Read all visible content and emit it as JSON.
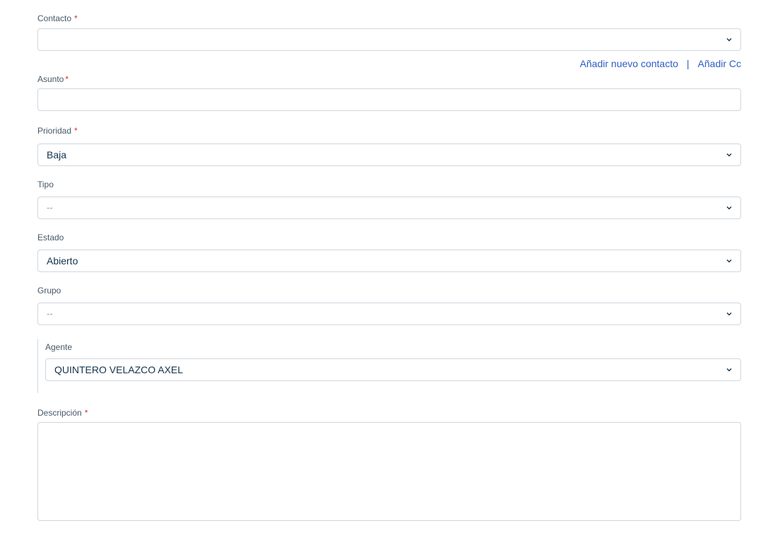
{
  "form": {
    "contact": {
      "label": "Contacto",
      "required_mark": "*",
      "value": ""
    },
    "contact_links": {
      "add_contact": "Añadir nuevo contacto",
      "separator": "|",
      "add_cc": "Añadir Cc"
    },
    "subject": {
      "label": "Asunto",
      "required_mark": "*",
      "value": ""
    },
    "priority": {
      "label": "Prioridad",
      "required_mark": "*",
      "value": "Baja"
    },
    "type": {
      "label": "Tipo",
      "value": "--"
    },
    "status": {
      "label": "Estado",
      "value": "Abierto"
    },
    "group": {
      "label": "Grupo",
      "value": "--"
    },
    "agent": {
      "label": "Agente",
      "value": "QUINTERO VELAZCO AXEL"
    },
    "description": {
      "label": "Descripción",
      "required_mark": "*",
      "value": ""
    }
  },
  "icons": {
    "dropdown": "chevron-down-icon"
  },
  "colors": {
    "link": "#2c5cc5",
    "required": "#d72d30",
    "border": "#cfd7df",
    "text": "#12344d"
  }
}
